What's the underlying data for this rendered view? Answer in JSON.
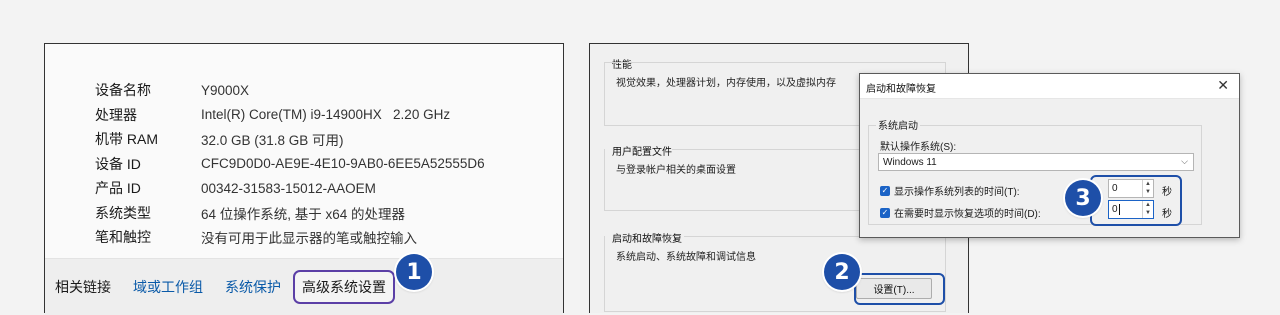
{
  "about": {
    "specs": [
      {
        "key": "设备名称",
        "value": "Y9000X"
      },
      {
        "key": "处理器",
        "value": "Intel(R) Core(TM) i9-14900HX   2.20 GHz"
      },
      {
        "key": "机带 RAM",
        "value": "32.0 GB (31.8 GB 可用)"
      },
      {
        "key": "设备 ID",
        "value": "CFC9D0D0-AE9E-4E10-9AB0-6EE5A52555D6"
      },
      {
        "key": "产品 ID",
        "value": "00342-31583-15012-AAOEM"
      },
      {
        "key": "系统类型",
        "value": "64 位操作系统, 基于 x64 的处理器"
      },
      {
        "key": "笔和触控",
        "value": "没有可用于此显示器的笔或触控输入"
      }
    ],
    "related": {
      "label": "相关链接",
      "links": [
        "域或工作组",
        "系统保护"
      ],
      "advanced": "高级系统设置"
    }
  },
  "badges": [
    "1",
    "2",
    "3"
  ],
  "system_properties": {
    "groups": [
      {
        "title": "性能",
        "desc": "视觉效果，处理器计划，内存使用，以及虚拟内存"
      },
      {
        "title": "用户配置文件",
        "desc": "与登录帐户相关的桌面设置"
      },
      {
        "title": "启动和故障恢复",
        "desc": "系统启动、系统故障和调试信息"
      }
    ],
    "settings_button": "设置(T)..."
  },
  "dialog": {
    "title": "启动和故障恢复",
    "close": "✕",
    "group_title": "系统启动",
    "default_os_label": "默认操作系统(S):",
    "default_os_value": "Windows 11",
    "show_list_label": "显示操作系统列表的时间(T):",
    "show_list_value": "0",
    "show_recovery_label": "在需要时显示恢复选项的时间(D):",
    "show_recovery_value": "0",
    "seconds": "秒"
  },
  "colors": {
    "accent": "#1e4fa8",
    "highlight_purple": "#5b3fa6",
    "link": "#0a5aa8"
  }
}
